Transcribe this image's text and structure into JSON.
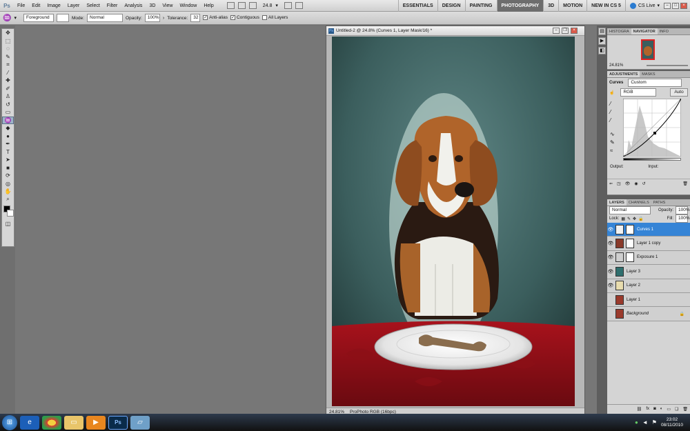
{
  "menubar": {
    "logo": "Ps",
    "items": [
      "File",
      "Edit",
      "Image",
      "Layer",
      "Select",
      "Filter",
      "Analysis",
      "3D",
      "View",
      "Window",
      "Help"
    ],
    "zoom": "24.8",
    "workspaces": [
      "ESSENTIALS",
      "DESIGN",
      "PAINTING",
      "PHOTOGRAPHY",
      "3D",
      "MOTION",
      "NEW IN CS 5"
    ],
    "active_workspace": "PHOTOGRAPHY",
    "cslive": "CS Live"
  },
  "options": {
    "fill_source": "Foreground",
    "mode_label": "Mode:",
    "mode_value": "Normal",
    "opacity_label": "Opacity:",
    "opacity_value": "100%",
    "tolerance_label": "Tolerance:",
    "tolerance_value": "32",
    "antialias": "Anti-alias",
    "contiguous": "Contiguous",
    "all_layers": "All Layers"
  },
  "document": {
    "title": "Untitled-2 @ 24.8% (Curves 1, Layer Mask/16) *",
    "zoom": "24.81%",
    "profile": "ProPhoto RGB (16bpc)"
  },
  "navigator": {
    "tabs": [
      "HISTOGRA",
      "NAVIGATOR",
      "INFO"
    ],
    "active": "NAVIGATOR",
    "zoom": "24.81%"
  },
  "adjustments": {
    "tabs": [
      "ADJUSTMENTS",
      "MASKS"
    ],
    "active": "ADJUSTMENTS",
    "title": "Curves",
    "preset": "Custom",
    "channel": "RGB",
    "auto": "Auto",
    "output": "Output:",
    "input": "Input:"
  },
  "layers_panel": {
    "tabs": [
      "LAYERS",
      "CHANNELS",
      "PATHS"
    ],
    "active": "LAYERS",
    "blend": "Normal",
    "opacity_label": "Opacity:",
    "opacity": "100%",
    "lock_label": "Lock:",
    "fill_label": "Fill:",
    "fill": "100%",
    "layers": [
      {
        "name": "Curves 1",
        "selected": true,
        "visible": true,
        "mask": true,
        "thumb": "#f2f2f2"
      },
      {
        "name": "Layer 1 copy",
        "selected": false,
        "visible": true,
        "mask": true,
        "thumb": "#8a3a2a"
      },
      {
        "name": "Exposure 1",
        "selected": false,
        "visible": true,
        "mask": true,
        "thumb": "#cfcfcf"
      },
      {
        "name": "Layer 3",
        "selected": false,
        "visible": true,
        "mask": false,
        "thumb": "#2f6f6e"
      },
      {
        "name": "Layer 2",
        "selected": false,
        "visible": true,
        "mask": false,
        "thumb": "#e8dcae"
      },
      {
        "name": "Layer 1",
        "selected": false,
        "visible": false,
        "mask": false,
        "thumb": "#9a3a2c"
      },
      {
        "name": "Background",
        "selected": false,
        "visible": false,
        "mask": false,
        "thumb": "#9a3a2c"
      }
    ]
  },
  "taskbar": {
    "apps": [
      "ie-icon",
      "chrome-icon",
      "folder-icon",
      "media-icon",
      "photoshop-icon",
      "window-icon"
    ],
    "time": "23:02",
    "date": "08/11/2010"
  }
}
